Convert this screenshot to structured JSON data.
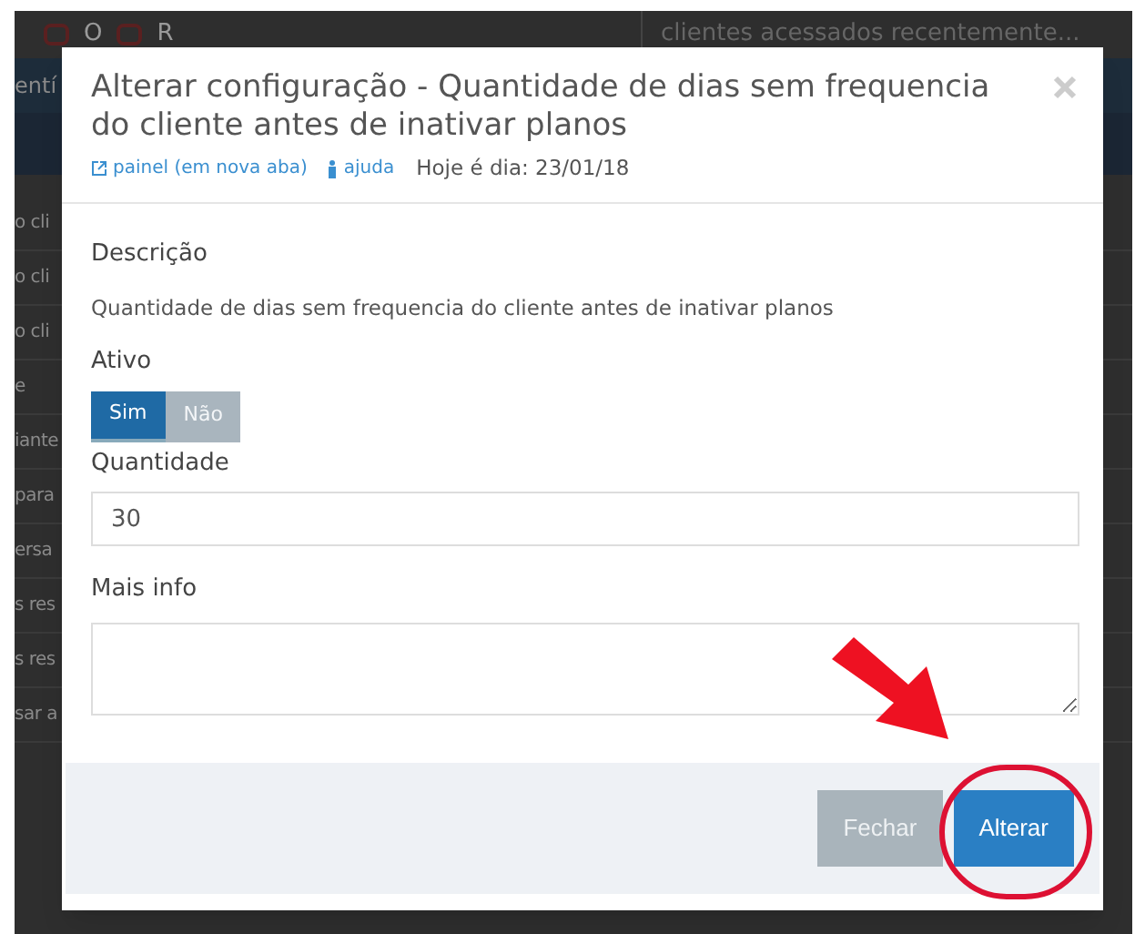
{
  "background": {
    "toolbar": {
      "items": [
        "O",
        "R"
      ],
      "search_placeholder": "clientes acessados recentemente..."
    },
    "nav_label": "entí",
    "list_rows": [
      "o cli",
      "o cli",
      "o cli",
      "e",
      "iante",
      "para",
      "ersa",
      "s res",
      "s res",
      "sar a"
    ]
  },
  "modal": {
    "title": "Alterar configuração - Quantidade de dias sem frequencia do cliente antes de inativar planos",
    "links": [
      {
        "label": "painel (em nova aba)",
        "kind": "external"
      },
      {
        "label": "ajuda",
        "kind": "help"
      }
    ],
    "date_text": "Hoje é dia: 23/01/18",
    "description_label": "Descrição",
    "description": "Quantidade de dias sem frequencia do cliente antes de inativar planos",
    "active_label": "Ativo",
    "active_options": [
      {
        "label": "Sim",
        "selected": true
      },
      {
        "label": "Não",
        "selected": false
      }
    ],
    "quantity_label": "Quantidade",
    "quantity_value": "30",
    "info_label": "Mais info",
    "buttons": [
      {
        "label": "Fechar",
        "kind": "secondary",
        "highlighted": false
      },
      {
        "label": "Alterar",
        "kind": "primary",
        "highlighted": true
      }
    ]
  }
}
